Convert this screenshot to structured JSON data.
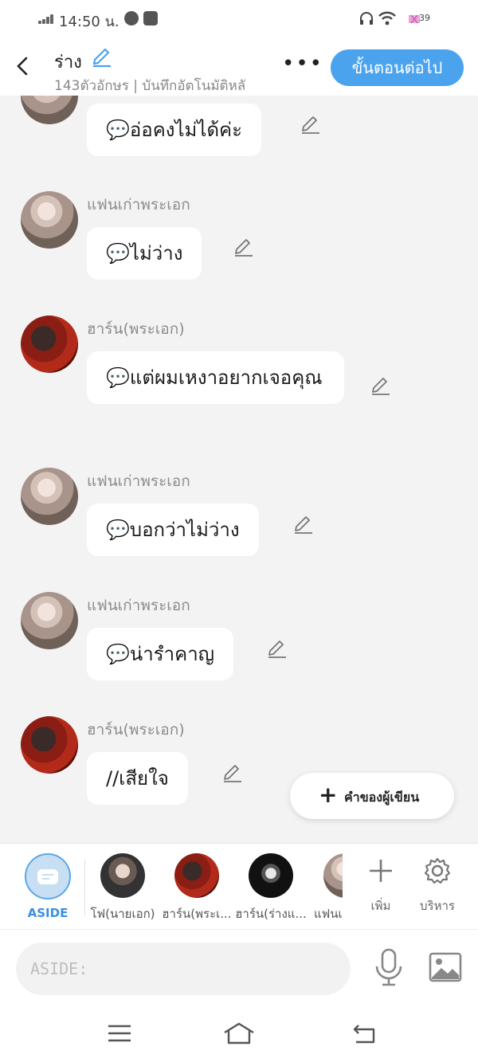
{
  "status": {
    "time": "14:50",
    "time_suffix": "น.",
    "battery": "39"
  },
  "header": {
    "title": "ร่าง",
    "subtitle": "143ตัวอักษร | บันทึกอัตโนมัติหลั",
    "more": "•••",
    "next_label": "ขั้นตอนต่อไป"
  },
  "messages": [
    {
      "sender": "",
      "text": "💬อ่อคงไม่ได้ค่ะ",
      "avatar": "girl"
    },
    {
      "sender": "แฟนเก่าพระเอก",
      "text": "💬ไม่ว่าง",
      "avatar": "girl"
    },
    {
      "sender": "ฮาร์น(พระเอก)",
      "text": "💬แต่ผมเหงาอยากเจอคุณ",
      "avatar": "boy"
    },
    {
      "sender": "แฟนเก่าพระเอก",
      "text": "💬บอกว่าไม่ว่าง",
      "avatar": "girl"
    },
    {
      "sender": "แฟนเก่าพระเอก",
      "text": "💬น่ารำคาญ",
      "avatar": "girl"
    },
    {
      "sender": "ฮาร์น(พระเอก)",
      "text": "//เสียใจ",
      "avatar": "boy"
    }
  ],
  "fab": {
    "plus": "+",
    "label": "คำของผู้เขียน"
  },
  "characters": {
    "aside": "ASIDE",
    "list": [
      "โฟ(นายเอก)",
      "ฮาร์น(พระเ...",
      "ฮาร์น(ร่างแ...",
      "แฟนเ"
    ],
    "add_label": "เพิ่ม",
    "manage_label": "บริหาร"
  },
  "input": {
    "placeholder": "ASIDE:"
  },
  "colors": {
    "accent": "#4ba3ee",
    "bubble": "#ffffff",
    "background": "#f3f3f3"
  }
}
